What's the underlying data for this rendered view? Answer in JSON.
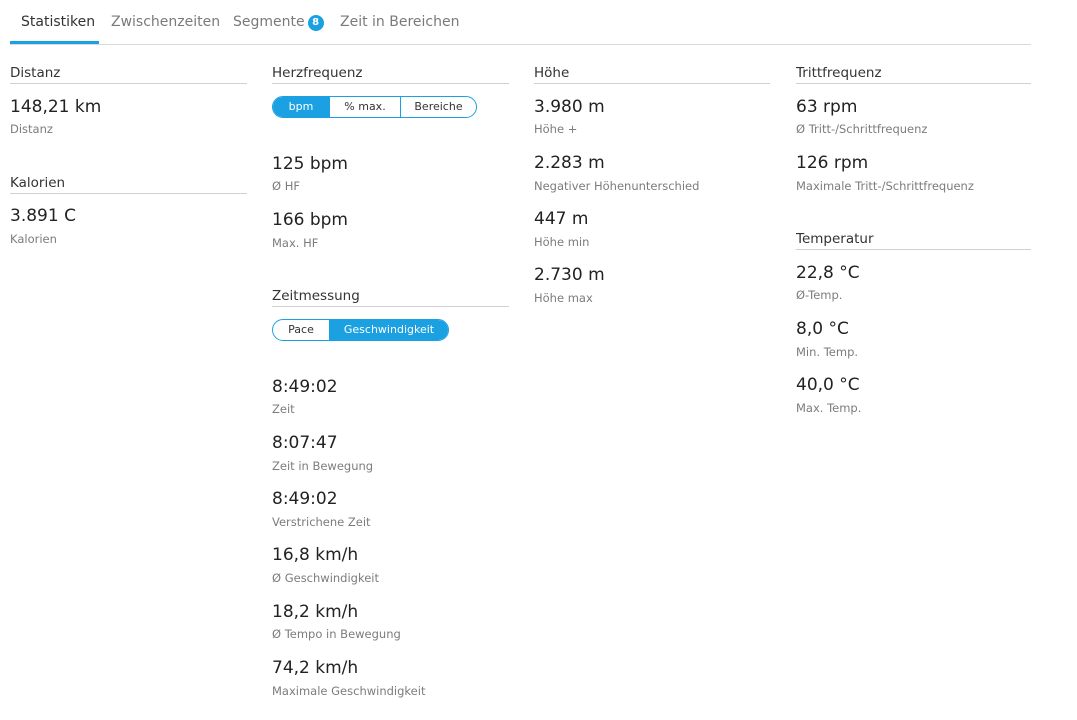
{
  "tabs": [
    {
      "label": "Statistiken",
      "active": true
    },
    {
      "label": "Zwischenzeiten",
      "active": false
    },
    {
      "label": "Segmente",
      "badge": "8",
      "active": false
    },
    {
      "label": "Zeit in Bereichen",
      "active": false
    }
  ],
  "accent_color": "#1ba1e2",
  "distanz": {
    "title": "Distanz",
    "value": "148,21 km",
    "label": "Distanz"
  },
  "kalorien": {
    "title": "Kalorien",
    "value": "3.891 C",
    "label": "Kalorien"
  },
  "herzfrequenz": {
    "title": "Herzfrequenz",
    "toggle": [
      "bpm",
      "% max.",
      "Bereiche"
    ],
    "toggle_selected": "bpm",
    "stats": [
      {
        "value": "125 bpm",
        "label": "Ø HF"
      },
      {
        "value": "166 bpm",
        "label": "Max. HF"
      }
    ]
  },
  "zeitmessung": {
    "title": "Zeitmessung",
    "toggle": [
      "Pace",
      "Geschwindigkeit"
    ],
    "toggle_selected": "Geschwindigkeit",
    "stats": [
      {
        "value": "8:49:02",
        "label": "Zeit"
      },
      {
        "value": "8:07:47",
        "label": "Zeit in Bewegung"
      },
      {
        "value": "8:49:02",
        "label": "Verstrichene Zeit"
      },
      {
        "value": "16,8 km/h",
        "label": "Ø Geschwindigkeit"
      },
      {
        "value": "18,2 km/h",
        "label": "Ø Tempo in Bewegung"
      },
      {
        "value": "74,2 km/h",
        "label": "Maximale Geschwindigkeit"
      }
    ]
  },
  "hoehe": {
    "title": "Höhe",
    "stats": [
      {
        "value": "3.980 m",
        "label": "Höhe +"
      },
      {
        "value": "2.283 m",
        "label": "Negativer Höhenunterschied"
      },
      {
        "value": "447 m",
        "label": "Höhe min"
      },
      {
        "value": "2.730 m",
        "label": "Höhe max"
      }
    ]
  },
  "trittfrequenz": {
    "title": "Trittfrequenz",
    "stats": [
      {
        "value": "63 rpm",
        "label": "Ø Tritt-/Schrittfrequenz"
      },
      {
        "value": "126 rpm",
        "label": "Maximale Tritt-/Schrittfrequenz"
      }
    ]
  },
  "temperatur": {
    "title": "Temperatur",
    "stats": [
      {
        "value": "22,8 °C",
        "label": "Ø-Temp."
      },
      {
        "value": "8,0 °C",
        "label": "Min. Temp."
      },
      {
        "value": "40,0 °C",
        "label": "Max. Temp."
      }
    ]
  }
}
